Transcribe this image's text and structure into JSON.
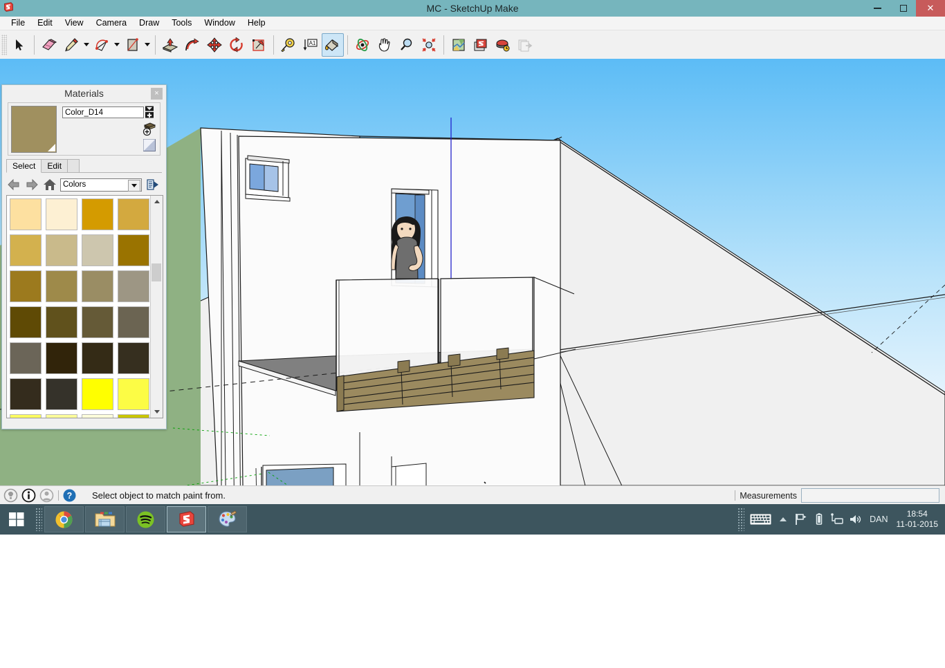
{
  "window": {
    "title": "MC - SketchUp Make",
    "app_icon": "sketchup-logo-icon",
    "controls": {
      "minimize": "minimize-icon",
      "maximize": "maximize-icon",
      "close": "✕"
    },
    "titlebar_color": "#76b5bd",
    "close_color": "#c75b5b"
  },
  "menubar": {
    "items": [
      "File",
      "Edit",
      "View",
      "Camera",
      "Draw",
      "Tools",
      "Window",
      "Help"
    ]
  },
  "toolbar": {
    "groups": [
      {
        "tools": [
          {
            "name": "select-tool",
            "icon": "arrow-cursor-icon",
            "active": false
          }
        ]
      },
      {
        "tools": [
          {
            "name": "eraser-tool",
            "icon": "eraser-icon",
            "active": false
          },
          {
            "name": "line-tool",
            "icon": "pencil-icon",
            "active": false,
            "dropdown": true
          },
          {
            "name": "arc-tool",
            "icon": "arc-icon",
            "active": false,
            "dropdown": true
          },
          {
            "name": "rectangle-tool",
            "icon": "rectangle-icon",
            "active": false,
            "dropdown": true
          }
        ]
      },
      {
        "tools": [
          {
            "name": "pushpull-tool",
            "icon": "pushpull-icon",
            "active": false
          },
          {
            "name": "followme-tool",
            "icon": "followme-icon",
            "active": false
          },
          {
            "name": "move-tool",
            "icon": "move-arrows-icon",
            "active": false
          },
          {
            "name": "rotate-tool",
            "icon": "rotate-icon",
            "active": false
          },
          {
            "name": "scale-tool",
            "icon": "scale-icon",
            "active": false
          }
        ]
      },
      {
        "tools": [
          {
            "name": "tape-measure-tool",
            "icon": "tape-measure-icon",
            "active": false
          },
          {
            "name": "text-tool",
            "icon": "text-a1-icon",
            "active": false
          },
          {
            "name": "paint-bucket-tool",
            "icon": "paint-bucket-icon",
            "active": true
          }
        ]
      },
      {
        "tools": [
          {
            "name": "orbit-tool",
            "icon": "orbit-icon",
            "active": false
          },
          {
            "name": "pan-tool",
            "icon": "hand-icon",
            "active": false
          },
          {
            "name": "zoom-tool",
            "icon": "magnifier-icon",
            "active": false
          },
          {
            "name": "zoom-extents-tool",
            "icon": "zoom-extents-icon",
            "active": false
          }
        ]
      },
      {
        "tools": [
          {
            "name": "add-location-tool",
            "icon": "map-icon",
            "active": false
          },
          {
            "name": "photo-texture-tool",
            "icon": "photo-texture-icon",
            "active": false
          },
          {
            "name": "shadow-settings-tool",
            "icon": "shadows-icon",
            "active": false
          },
          {
            "name": "share-model-tool",
            "icon": "share-model-icon",
            "active": false,
            "disabled": true
          }
        ]
      }
    ]
  },
  "materials_panel": {
    "title": "Materials",
    "close_label": "×",
    "current_material": {
      "name": "Color_D14",
      "color": "#a0905f"
    },
    "side_buttons": [
      {
        "name": "create-material-button",
        "icon": "create-material-icon"
      },
      {
        "name": "add-to-model-button",
        "icon": "add-to-model-icon"
      },
      {
        "name": "default-material-button",
        "icon": "default-material-icon"
      }
    ],
    "tabs": [
      {
        "label": "Select",
        "selected": true
      },
      {
        "label": "Edit",
        "selected": false
      }
    ],
    "eyedropper": "eyedropper-icon",
    "nav": {
      "back": "back-arrow-icon",
      "forward": "forward-arrow-icon",
      "home": "home-icon",
      "library": "Colors",
      "details": "details-icon"
    },
    "swatch_colors": [
      "#fde0a0",
      "#fdf0d3",
      "#d49b00",
      "#d3a93f",
      "#d3b14e",
      "#c9ba8b",
      "#cdc6ae",
      "#9a7300",
      "#9c7a1e",
      "#9e8a4a",
      "#9a8d64",
      "#9d9684",
      "#5f4a05",
      "#60511c",
      "#655a37",
      "#6b6452",
      "#6b6558",
      "#31240a",
      "#342b16",
      "#362f1f",
      "#342c1d",
      "#35322a",
      "#ffff00",
      "#fcfc45",
      "#fdfc60",
      "#fdfd9a",
      "#fefedb",
      "#c9c505"
    ],
    "scrollbar": {
      "up": "scroll-up-icon",
      "down": "scroll-down-icon"
    }
  },
  "viewport": {
    "sky_top": "#63bdf5",
    "sky_bottom": "#dff1fc",
    "ground": "#8fb183",
    "face_light": "#f2f2f2",
    "face_shadow": "#808080",
    "wood_color": "#9b8a5f",
    "glass_color": "#6b9dc4",
    "axis_blue": "#2222cc",
    "axis_green": "#00a000"
  },
  "statusbar": {
    "icons": [
      "help-bulb-icon",
      "info-icon",
      "person-icon",
      "question-icon"
    ],
    "message": "Select object to match paint from.",
    "measurements_label": "Measurements",
    "measurements_value": "",
    "measurements_placeholder": ""
  },
  "taskbar": {
    "start": "windows-start-icon",
    "buttons": [
      {
        "name": "taskbar-chrome",
        "icon": "chrome-icon",
        "running": false
      },
      {
        "name": "taskbar-file-explorer",
        "icon": "folder-explorer-icon",
        "running": false
      },
      {
        "name": "taskbar-spotify",
        "icon": "spotify-icon",
        "running": false
      },
      {
        "name": "taskbar-sketchup",
        "icon": "sketchup-icon",
        "running": true
      },
      {
        "name": "taskbar-paint",
        "icon": "paint-palette-icon",
        "running": false
      }
    ],
    "tray": {
      "keyboard": "keyboard-icon",
      "show_hidden": "show-hidden-icon",
      "flag": "action-center-flag-icon",
      "battery": "battery-icon",
      "network": "network-icon",
      "volume": "volume-icon",
      "language": "DAN",
      "time": "18:54",
      "date": "11-01-2015"
    }
  }
}
